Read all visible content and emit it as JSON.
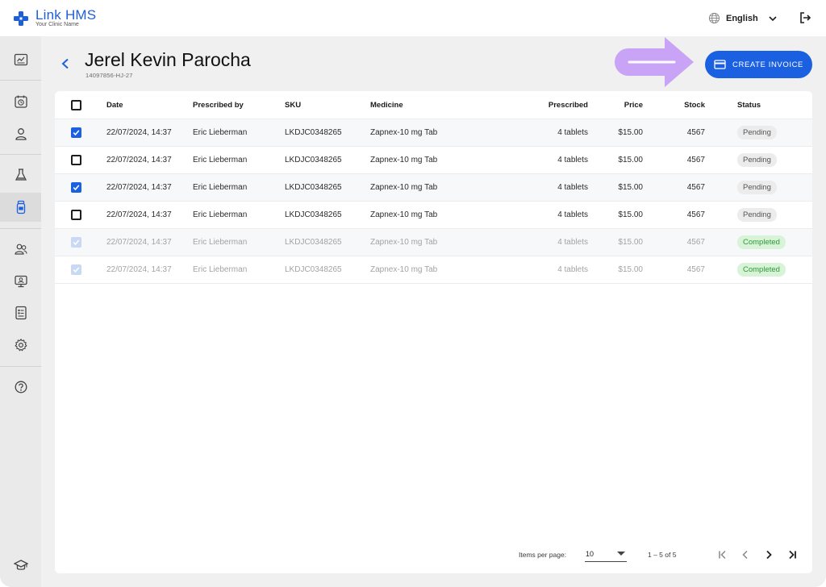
{
  "app": {
    "name_part1": "Link",
    "name_part2": "HMS",
    "subtitle": "Your Clinic Name",
    "brand_color": "#1a60e0"
  },
  "topbar": {
    "language": "English",
    "language_icon": "globe-icon",
    "logout_icon": "logout-icon"
  },
  "sidebar": {
    "items": [
      {
        "icon": "dashboard-icon",
        "active": false
      },
      {
        "icon": "calendar-icon",
        "active": false
      },
      {
        "icon": "person-icon",
        "active": false
      },
      {
        "icon": "lab-flask-icon",
        "active": false
      },
      {
        "icon": "medicine-bottle-icon",
        "active": true
      },
      {
        "icon": "users-icon",
        "active": false
      },
      {
        "icon": "monitor-icon",
        "active": false
      },
      {
        "icon": "document-icon",
        "active": false
      },
      {
        "icon": "settings-icon",
        "active": false
      },
      {
        "icon": "help-icon",
        "active": false
      },
      {
        "icon": "graduation-cap-icon",
        "active": false
      }
    ]
  },
  "patient": {
    "name": "Jerel Kevin Parocha",
    "id": "14097856-HJ-27"
  },
  "actions": {
    "create_invoice": "CREATE INVOICE"
  },
  "table": {
    "columns": [
      "Date",
      "Prescribed by",
      "SKU",
      "Medicine",
      "Prescribed",
      "Price",
      "Stock",
      "Status"
    ],
    "rows": [
      {
        "checked": true,
        "disabled": false,
        "date": "22/07/2024, 14:37",
        "prescribed_by": "Eric Lieberman",
        "sku": "LKDJC0348265",
        "medicine": "Zapnex-10 mg Tab",
        "prescribed": "4 tablets",
        "price": "$15.00",
        "stock": "4567",
        "status": "Pending"
      },
      {
        "checked": false,
        "disabled": false,
        "date": "22/07/2024, 14:37",
        "prescribed_by": "Eric Lieberman",
        "sku": "LKDJC0348265",
        "medicine": "Zapnex-10 mg Tab",
        "prescribed": "4 tablets",
        "price": "$15.00",
        "stock": "4567",
        "status": "Pending"
      },
      {
        "checked": true,
        "disabled": false,
        "date": "22/07/2024, 14:37",
        "prescribed_by": "Eric Lieberman",
        "sku": "LKDJC0348265",
        "medicine": "Zapnex-10 mg Tab",
        "prescribed": "4 tablets",
        "price": "$15.00",
        "stock": "4567",
        "status": "Pending"
      },
      {
        "checked": false,
        "disabled": false,
        "date": "22/07/2024, 14:37",
        "prescribed_by": "Eric Lieberman",
        "sku": "LKDJC0348265",
        "medicine": "Zapnex-10 mg Tab",
        "prescribed": "4 tablets",
        "price": "$15.00",
        "stock": "4567",
        "status": "Pending"
      },
      {
        "checked": true,
        "disabled": true,
        "date": "22/07/2024, 14:37",
        "prescribed_by": "Eric Lieberman",
        "sku": "LKDJC0348265",
        "medicine": "Zapnex-10 mg Tab",
        "prescribed": "4 tablets",
        "price": "$15.00",
        "stock": "4567",
        "status": "Completed"
      },
      {
        "checked": true,
        "disabled": true,
        "date": "22/07/2024, 14:37",
        "prescribed_by": "Eric Lieberman",
        "sku": "LKDJC0348265",
        "medicine": "Zapnex-10 mg Tab",
        "prescribed": "4 tablets",
        "price": "$15.00",
        "stock": "4567",
        "status": "Completed"
      }
    ]
  },
  "pagination": {
    "items_per_page_label": "Items per page:",
    "items_per_page": "10",
    "range": "1 – 5 of 5"
  },
  "annotation": {
    "arrow_color": "#c9a3f5"
  }
}
